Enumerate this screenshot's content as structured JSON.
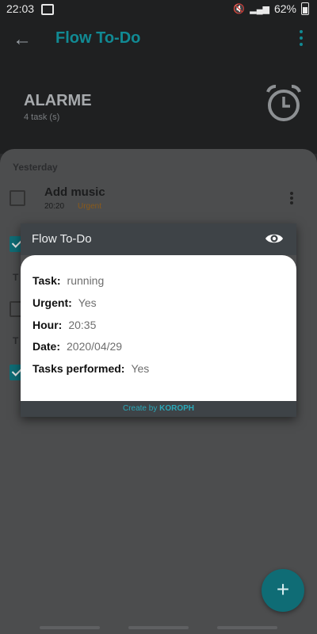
{
  "status_bar": {
    "time": "22:03",
    "battery": "62%"
  },
  "app_bar": {
    "back_icon": "arrow-left-icon",
    "title": "Flow To-Do",
    "menu_icon": "more-vert-icon"
  },
  "header": {
    "list_name": "ALARME",
    "task_count": "4 task (s)",
    "icon": "alarm-clock-icon"
  },
  "list": {
    "section_yesterday": "Yesterday",
    "task": {
      "name": "Add music",
      "time": "20:20",
      "urgency": "Urgent"
    }
  },
  "dialog": {
    "title": "Flow To-Do",
    "eye_icon": "eye-icon",
    "fields": [
      {
        "label": "Task:",
        "value": "running"
      },
      {
        "label": "Urgent:",
        "value": "Yes"
      },
      {
        "label": "Hour:",
        "value": "20:35"
      },
      {
        "label": "Date:",
        "value": "2020/04/29"
      },
      {
        "label": "Tasks performed:",
        "value": "Yes"
      }
    ],
    "footer_prefix": "Create by",
    "footer_author": "KOROPH"
  },
  "fab": {
    "label": "+"
  },
  "colors": {
    "accent": "#118a94",
    "urgent": "#8a5a1a"
  }
}
